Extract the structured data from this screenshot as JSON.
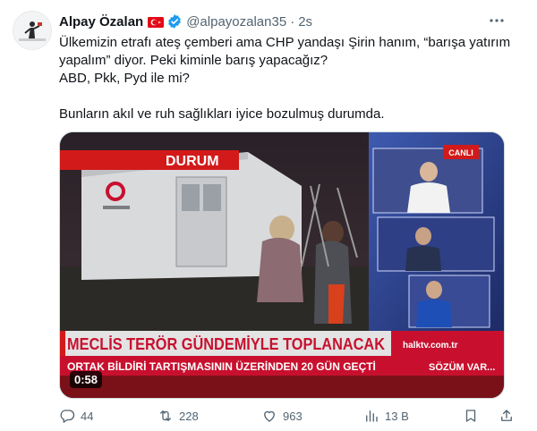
{
  "tweet": {
    "author_name": "Alpay Özalan",
    "handle": "@alpayozalan35",
    "separator": "·",
    "time": "2s",
    "text_lines": [
      "Ülkemizin etrafı ateş çemberi ama CHP yandaşı Şirin hanım, “barışa yatırım",
      "yapalım” diyor. Peki kiminle barış yapacağız?",
      "ABD, Pkk, Pyd ile mi?"
    ],
    "text_line_2": "Bunların akıl ve ruh sağlıkları iyice bozulmuş durumda."
  },
  "icons": {
    "flag": "turkey-flag-icon",
    "verified": "verified-badge-icon",
    "more": "more-options-icon",
    "reply": "reply-icon",
    "retweet": "retweet-icon",
    "like": "like-icon",
    "views": "views-icon",
    "bookmark": "bookmark-icon",
    "share": "share-icon"
  },
  "video": {
    "duration": "0:58",
    "top_banner": "DURUM",
    "headline": "MECLİS TERÖR GÜNDEMİYLE TOPLANACAK",
    "subheadline": "ORTAK BİLDİRİ TARTIŞMASININ ÜZERİNDEN 20 GÜN GEÇTİ",
    "channel_logo": "halktv.com.tr",
    "program": "SÖZÜM VAR...",
    "live_badge": "CANLI"
  },
  "metrics": {
    "replies": "44",
    "retweets": "228",
    "likes": "963",
    "views": "13 B"
  },
  "colors": {
    "text_primary": "#0f1419",
    "text_secondary": "#536471",
    "verified_blue": "#1d9bf0",
    "flag_red": "#e30a17",
    "news_red": "#d21a1a"
  }
}
